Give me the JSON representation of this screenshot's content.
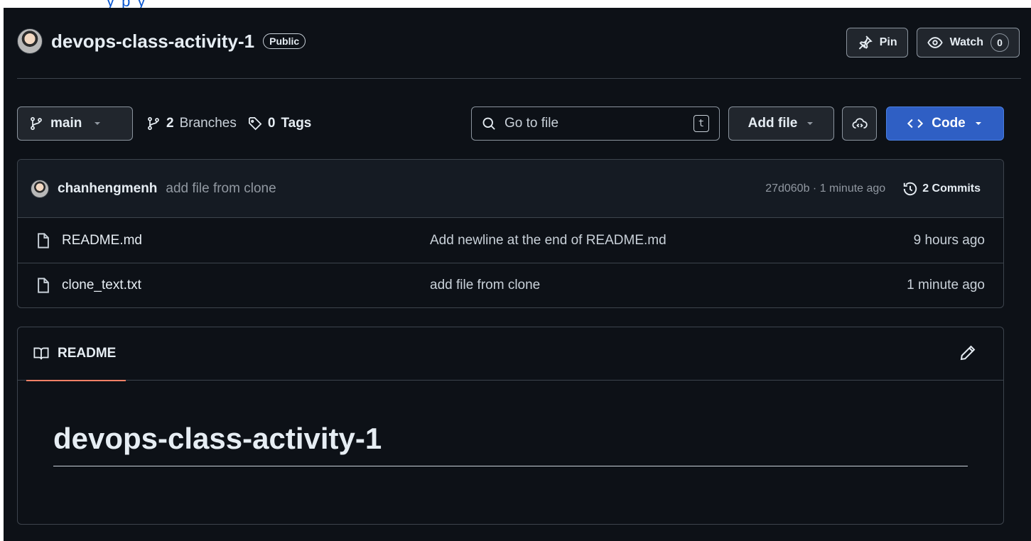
{
  "top_strip": {
    "link_text": "y   p  y"
  },
  "repo": {
    "name": "devops-class-activity-1",
    "visibility": "Public"
  },
  "header_actions": {
    "pin_label": "Pin",
    "watch_label": "Watch",
    "watch_count": "0"
  },
  "toolbar": {
    "branch": "main",
    "branches_count": "2",
    "branches_label": "Branches",
    "tags_count": "0",
    "tags_label": "Tags",
    "search_placeholder": "Go to file",
    "search_shortcut": "t",
    "add_file_label": "Add file",
    "code_label": "Code"
  },
  "latest_commit": {
    "author": "chanhengmenh",
    "message": "add file from clone",
    "sha_time": "27d060b · 1 minute ago",
    "commits_label": "2 Commits"
  },
  "files": [
    {
      "name": "README.md",
      "message": "Add newline at the end of README.md",
      "time": "9 hours ago"
    },
    {
      "name": "clone_text.txt",
      "message": "add file from clone",
      "time": "1 minute ago"
    }
  ],
  "readme": {
    "tab_label": "README",
    "heading": "devops-class-activity-1"
  },
  "colors": {
    "background": "#0d1117",
    "accent_blue": "#2f5fc4",
    "tab_underline": "#f78166",
    "border": "#3d444d"
  },
  "icons": [
    "pin-icon",
    "eye-icon",
    "branch-icon",
    "tag-icon",
    "search-icon",
    "codespaces-icon",
    "code-icon",
    "history-icon",
    "file-icon",
    "book-icon",
    "pencil-icon",
    "caret-down-icon"
  ]
}
